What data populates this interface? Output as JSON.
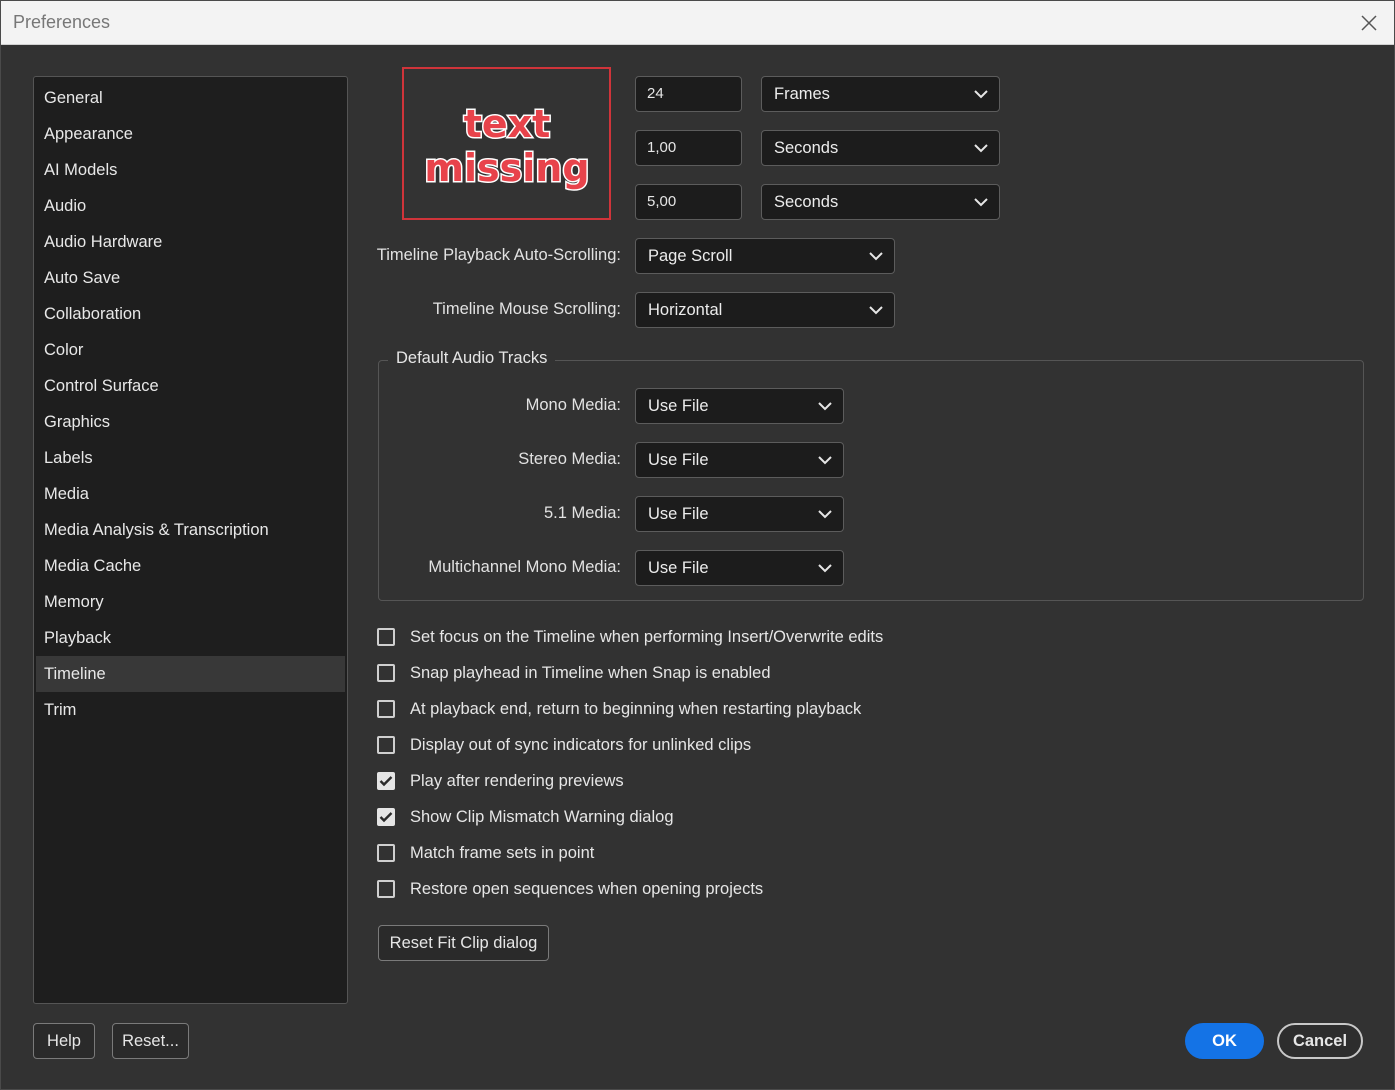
{
  "window": {
    "title": "Preferences"
  },
  "sidebar": {
    "items": [
      {
        "label": "General"
      },
      {
        "label": "Appearance"
      },
      {
        "label": "AI Models"
      },
      {
        "label": "Audio"
      },
      {
        "label": "Audio Hardware"
      },
      {
        "label": "Auto Save"
      },
      {
        "label": "Collaboration"
      },
      {
        "label": "Color"
      },
      {
        "label": "Control Surface"
      },
      {
        "label": "Graphics"
      },
      {
        "label": "Labels"
      },
      {
        "label": "Media"
      },
      {
        "label": "Media Analysis & Transcription"
      },
      {
        "label": "Media Cache"
      },
      {
        "label": "Memory"
      },
      {
        "label": "Playback"
      },
      {
        "label": "Timeline"
      },
      {
        "label": "Trim"
      }
    ],
    "selected": "Timeline"
  },
  "placeholder": {
    "line1": "text",
    "line2": "missing"
  },
  "durations": [
    {
      "value": "24",
      "unit": "Frames"
    },
    {
      "value": "1,00",
      "unit": "Seconds"
    },
    {
      "value": "5,00",
      "unit": "Seconds"
    }
  ],
  "scrolling": {
    "auto_label": "Timeline Playback Auto-Scrolling:",
    "auto_value": "Page Scroll",
    "mouse_label": "Timeline Mouse Scrolling:",
    "mouse_value": "Horizontal"
  },
  "audio_tracks": {
    "title": "Default Audio Tracks",
    "rows": [
      {
        "label": "Mono Media:",
        "value": "Use File"
      },
      {
        "label": "Stereo Media:",
        "value": "Use File"
      },
      {
        "label": "5.1 Media:",
        "value": "Use File"
      },
      {
        "label": "Multichannel Mono Media:",
        "value": "Use File"
      }
    ]
  },
  "checkboxes": [
    {
      "label": "Set focus on the Timeline when performing Insert/Overwrite edits",
      "checked": false
    },
    {
      "label": "Snap playhead in Timeline when Snap is enabled",
      "checked": false
    },
    {
      "label": "At playback end, return to beginning when restarting playback",
      "checked": false
    },
    {
      "label": "Display out of sync indicators for unlinked clips",
      "checked": false
    },
    {
      "label": "Play after rendering previews",
      "checked": true
    },
    {
      "label": "Show Clip Mismatch Warning dialog",
      "checked": true
    },
    {
      "label": "Match frame sets in point",
      "checked": false
    },
    {
      "label": "Restore open sequences when opening projects",
      "checked": false
    }
  ],
  "buttons": {
    "reset_fit_clip": "Reset Fit Clip dialog",
    "help": "Help",
    "reset": "Reset...",
    "ok": "OK",
    "cancel": "Cancel"
  },
  "colors": {
    "accent": "#1473e6",
    "background": "#323232",
    "sidebar_bg": "#1e1e1e",
    "placeholder_border": "#d0343a"
  }
}
